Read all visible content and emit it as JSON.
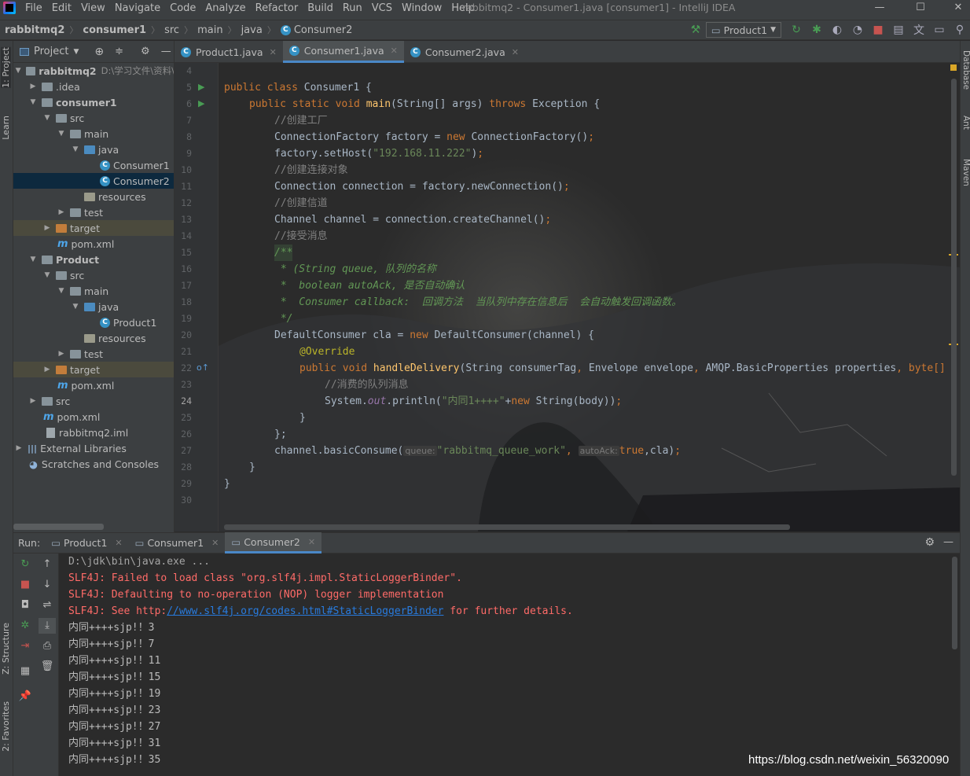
{
  "menubar": {
    "items": [
      "File",
      "Edit",
      "View",
      "Navigate",
      "Code",
      "Analyze",
      "Refactor",
      "Build",
      "Run",
      "VCS",
      "Window",
      "Help"
    ],
    "window_title": "rabbitmq2 - Consumer1.java [consumer1] - IntelliJ IDEA"
  },
  "navbar": {
    "crumbs": [
      "rabbitmq2",
      "consumer1",
      "src",
      "main",
      "java",
      "Consumer2"
    ],
    "run_config": "Product1"
  },
  "left_stripe": {
    "project": "1: Project",
    "learn": "Learn",
    "structure": "Z: Structure",
    "favorites": "2: Favorites"
  },
  "right_stripe": {
    "database": "Database",
    "ant": "Ant",
    "maven": "Maven"
  },
  "project_panel": {
    "title": "Project",
    "tree": [
      {
        "label": "rabbitmq2",
        "extra": "D:\\学习文件\\资料\\",
        "bold": true
      },
      {
        "label": ".idea"
      },
      {
        "label": "consumer1",
        "bold": true
      },
      {
        "label": "src"
      },
      {
        "label": "main"
      },
      {
        "label": "java"
      },
      {
        "label": "Consumer1"
      },
      {
        "label": "Consumer2"
      },
      {
        "label": "resources"
      },
      {
        "label": "test"
      },
      {
        "label": "target"
      },
      {
        "label": "pom.xml"
      },
      {
        "label": "Product",
        "bold": true
      },
      {
        "label": "src"
      },
      {
        "label": "main"
      },
      {
        "label": "java"
      },
      {
        "label": "Product1"
      },
      {
        "label": "resources"
      },
      {
        "label": "test"
      },
      {
        "label": "target"
      },
      {
        "label": "pom.xml"
      },
      {
        "label": "src"
      },
      {
        "label": "pom.xml"
      },
      {
        "label": "rabbitmq2.iml"
      },
      {
        "label": "External Libraries"
      },
      {
        "label": "Scratches and Consoles"
      }
    ]
  },
  "editor_tabs": [
    "Product1.java",
    "Consumer1.java",
    "Consumer2.java"
  ],
  "editor": {
    "line_numbers": [
      "4",
      "5",
      "6",
      "7",
      "8",
      "9",
      "10",
      "11",
      "12",
      "13",
      "14",
      "15",
      "16",
      "17",
      "18",
      "19",
      "20",
      "21",
      "22",
      "23",
      "24",
      "25",
      "26",
      "27",
      "28",
      "29",
      "30"
    ],
    "lines": {
      "l5_kw": "public class ",
      "l5_name": "Consumer1 {",
      "l6_kw": "public static void ",
      "l6_fn": "main",
      "l6_rest": "(String[] args) ",
      "l6_throws": "throws ",
      "l6_end": "Exception {",
      "l7": "//创建工厂",
      "l8_a": "ConnectionFactory factory = ",
      "l8_new": "new ",
      "l8_b": "ConnectionFactory()",
      "l8_semi": ";",
      "l9_a": "factory.setHost(",
      "l9_str": "\"192.168.11.222\"",
      "l9_b": ")",
      "l9_semi": ";",
      "l10": "//创建连接对象",
      "l11_a": "Connection connection = factory.newConnection()",
      "l11_semi": ";",
      "l12": "//创建信道",
      "l13_a": "Channel channel = connection.createChannel()",
      "l13_semi": ";",
      "l14": "//接受消息",
      "l15": "/**",
      "l16": " * (String queue, 队列的名称",
      "l17": " *  boolean autoAck, 是否自动确认",
      "l18": " *  Consumer callback:  回调方法  当队列中存在信息后  会自动触发回调函数。",
      "l19": " */",
      "l20_a": "DefaultConsumer cla = ",
      "l20_new": "new ",
      "l20_b": "DefaultConsumer(channel) {",
      "l21": "@Override",
      "l22_kw": "public void ",
      "l22_fn": "handleDelivery",
      "l22_a": "(String consumerTag",
      "l22_c1": ", ",
      "l22_b": "Envelope envelope",
      "l22_c2": ", ",
      "l22_c": "AMQP.BasicProperties properties",
      "l22_c3": ", ",
      "l22_d": "byte[]",
      "l23": "//消费的队列消息",
      "l24_a": "System.",
      "l24_out": "out",
      "l24_b": ".println(",
      "l24_str": "\"内同1++++\"",
      "l24_plus": "+",
      "l24_new": "new ",
      "l24_c": "String(body))",
      "l24_semi": ";",
      "l25": "}",
      "l26": "};",
      "l27_a": "channel.basicConsume(",
      "l27_h1": "queue:",
      "l27_str": "\"rabbitmq_queue_work\"",
      "l27_c": ", ",
      "l27_h2": "autoAck:",
      "l27_true": "true",
      "l27_d": ",cla)",
      "l27_semi": ";",
      "l28": "}",
      "l29": "}"
    }
  },
  "run_panel": {
    "label": "Run:",
    "tabs": [
      "Product1",
      "Consumer1",
      "Consumer2"
    ]
  },
  "console": {
    "cmd": "D:\\jdk\\bin\\java.exe ...",
    "err1": "SLF4J: Failed to load class \"org.slf4j.impl.StaticLoggerBinder\".",
    "err2": "SLF4J: Defaulting to no-operation (NOP) logger implementation",
    "err3_a": "SLF4J: See http:",
    "err3_link": "//www.slf4j.org/codes.html#StaticLoggerBinder",
    "err3_b": " for further details.",
    "output": [
      "内同++++sjp!！3",
      "内同++++sjp!！7",
      "内同++++sjp!！11",
      "内同++++sjp!！15",
      "内同++++sjp!！19",
      "内同++++sjp!！23",
      "内同++++sjp!！27",
      "内同++++sjp!！31",
      "内同++++sjp!！35"
    ]
  },
  "watermark": "https://blog.csdn.net/weixin_56320090",
  "colors": {
    "keyword": "#cc7832",
    "string": "#6a8759",
    "comment": "#808080",
    "doc": "#629755",
    "function": "#ffc66d",
    "error": "#ff6b68",
    "selection": "#0d293e",
    "accent": "#4a88c7"
  }
}
